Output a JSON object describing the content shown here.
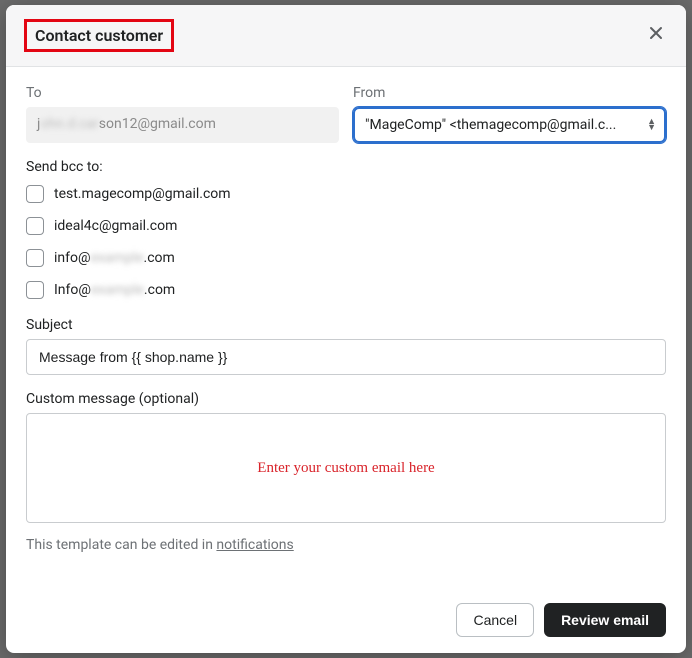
{
  "modal": {
    "title": "Contact customer"
  },
  "to": {
    "label": "To",
    "prefix": "j",
    "blurred": "ohn.d.car",
    "suffix": "son12@gmail.com"
  },
  "from": {
    "label": "From",
    "value": "\"MageComp\" <themagecomp@gmail.c..."
  },
  "bcc": {
    "label": "Send bcc to:",
    "items": [
      {
        "prefix": "test.magecomp@gmail.com",
        "blurred": "",
        "suffix": ""
      },
      {
        "prefix": "ideal4c@gmail.com",
        "blurred": "",
        "suffix": ""
      },
      {
        "prefix": "info@",
        "blurred": "example",
        "suffix": ".com"
      },
      {
        "prefix": "Info@",
        "blurred": "example",
        "suffix": ".com"
      }
    ]
  },
  "subject": {
    "label": "Subject",
    "value": "Message from {{ shop.name }}"
  },
  "custom": {
    "label": "Custom message (optional)",
    "annotation": "Enter your custom email here"
  },
  "footnote": {
    "text": "This template can be edited in ",
    "link": "notifications"
  },
  "buttons": {
    "cancel": "Cancel",
    "review": "Review email"
  }
}
